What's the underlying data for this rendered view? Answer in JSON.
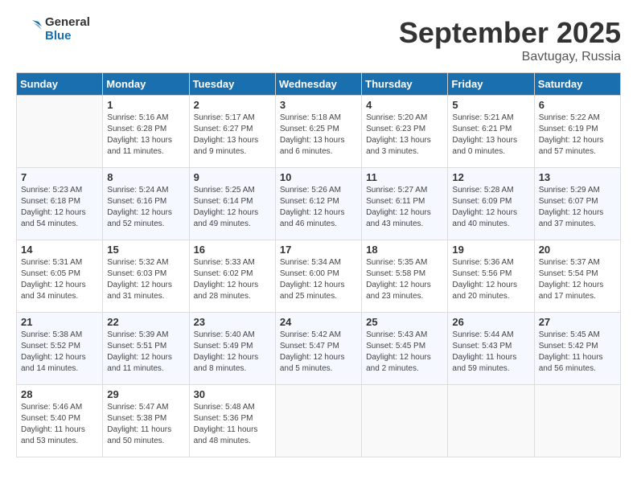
{
  "logo": {
    "text_general": "General",
    "text_blue": "Blue"
  },
  "title": "September 2025",
  "location": "Bavtugay, Russia",
  "days_of_week": [
    "Sunday",
    "Monday",
    "Tuesday",
    "Wednesday",
    "Thursday",
    "Friday",
    "Saturday"
  ],
  "weeks": [
    [
      {
        "day": "",
        "info": ""
      },
      {
        "day": "1",
        "info": "Sunrise: 5:16 AM\nSunset: 6:28 PM\nDaylight: 13 hours\nand 11 minutes."
      },
      {
        "day": "2",
        "info": "Sunrise: 5:17 AM\nSunset: 6:27 PM\nDaylight: 13 hours\nand 9 minutes."
      },
      {
        "day": "3",
        "info": "Sunrise: 5:18 AM\nSunset: 6:25 PM\nDaylight: 13 hours\nand 6 minutes."
      },
      {
        "day": "4",
        "info": "Sunrise: 5:20 AM\nSunset: 6:23 PM\nDaylight: 13 hours\nand 3 minutes."
      },
      {
        "day": "5",
        "info": "Sunrise: 5:21 AM\nSunset: 6:21 PM\nDaylight: 13 hours\nand 0 minutes."
      },
      {
        "day": "6",
        "info": "Sunrise: 5:22 AM\nSunset: 6:19 PM\nDaylight: 12 hours\nand 57 minutes."
      }
    ],
    [
      {
        "day": "7",
        "info": "Sunrise: 5:23 AM\nSunset: 6:18 PM\nDaylight: 12 hours\nand 54 minutes."
      },
      {
        "day": "8",
        "info": "Sunrise: 5:24 AM\nSunset: 6:16 PM\nDaylight: 12 hours\nand 52 minutes."
      },
      {
        "day": "9",
        "info": "Sunrise: 5:25 AM\nSunset: 6:14 PM\nDaylight: 12 hours\nand 49 minutes."
      },
      {
        "day": "10",
        "info": "Sunrise: 5:26 AM\nSunset: 6:12 PM\nDaylight: 12 hours\nand 46 minutes."
      },
      {
        "day": "11",
        "info": "Sunrise: 5:27 AM\nSunset: 6:11 PM\nDaylight: 12 hours\nand 43 minutes."
      },
      {
        "day": "12",
        "info": "Sunrise: 5:28 AM\nSunset: 6:09 PM\nDaylight: 12 hours\nand 40 minutes."
      },
      {
        "day": "13",
        "info": "Sunrise: 5:29 AM\nSunset: 6:07 PM\nDaylight: 12 hours\nand 37 minutes."
      }
    ],
    [
      {
        "day": "14",
        "info": "Sunrise: 5:31 AM\nSunset: 6:05 PM\nDaylight: 12 hours\nand 34 minutes."
      },
      {
        "day": "15",
        "info": "Sunrise: 5:32 AM\nSunset: 6:03 PM\nDaylight: 12 hours\nand 31 minutes."
      },
      {
        "day": "16",
        "info": "Sunrise: 5:33 AM\nSunset: 6:02 PM\nDaylight: 12 hours\nand 28 minutes."
      },
      {
        "day": "17",
        "info": "Sunrise: 5:34 AM\nSunset: 6:00 PM\nDaylight: 12 hours\nand 25 minutes."
      },
      {
        "day": "18",
        "info": "Sunrise: 5:35 AM\nSunset: 5:58 PM\nDaylight: 12 hours\nand 23 minutes."
      },
      {
        "day": "19",
        "info": "Sunrise: 5:36 AM\nSunset: 5:56 PM\nDaylight: 12 hours\nand 20 minutes."
      },
      {
        "day": "20",
        "info": "Sunrise: 5:37 AM\nSunset: 5:54 PM\nDaylight: 12 hours\nand 17 minutes."
      }
    ],
    [
      {
        "day": "21",
        "info": "Sunrise: 5:38 AM\nSunset: 5:52 PM\nDaylight: 12 hours\nand 14 minutes."
      },
      {
        "day": "22",
        "info": "Sunrise: 5:39 AM\nSunset: 5:51 PM\nDaylight: 12 hours\nand 11 minutes."
      },
      {
        "day": "23",
        "info": "Sunrise: 5:40 AM\nSunset: 5:49 PM\nDaylight: 12 hours\nand 8 minutes."
      },
      {
        "day": "24",
        "info": "Sunrise: 5:42 AM\nSunset: 5:47 PM\nDaylight: 12 hours\nand 5 minutes."
      },
      {
        "day": "25",
        "info": "Sunrise: 5:43 AM\nSunset: 5:45 PM\nDaylight: 12 hours\nand 2 minutes."
      },
      {
        "day": "26",
        "info": "Sunrise: 5:44 AM\nSunset: 5:43 PM\nDaylight: 11 hours\nand 59 minutes."
      },
      {
        "day": "27",
        "info": "Sunrise: 5:45 AM\nSunset: 5:42 PM\nDaylight: 11 hours\nand 56 minutes."
      }
    ],
    [
      {
        "day": "28",
        "info": "Sunrise: 5:46 AM\nSunset: 5:40 PM\nDaylight: 11 hours\nand 53 minutes."
      },
      {
        "day": "29",
        "info": "Sunrise: 5:47 AM\nSunset: 5:38 PM\nDaylight: 11 hours\nand 50 minutes."
      },
      {
        "day": "30",
        "info": "Sunrise: 5:48 AM\nSunset: 5:36 PM\nDaylight: 11 hours\nand 48 minutes."
      },
      {
        "day": "",
        "info": ""
      },
      {
        "day": "",
        "info": ""
      },
      {
        "day": "",
        "info": ""
      },
      {
        "day": "",
        "info": ""
      }
    ]
  ]
}
